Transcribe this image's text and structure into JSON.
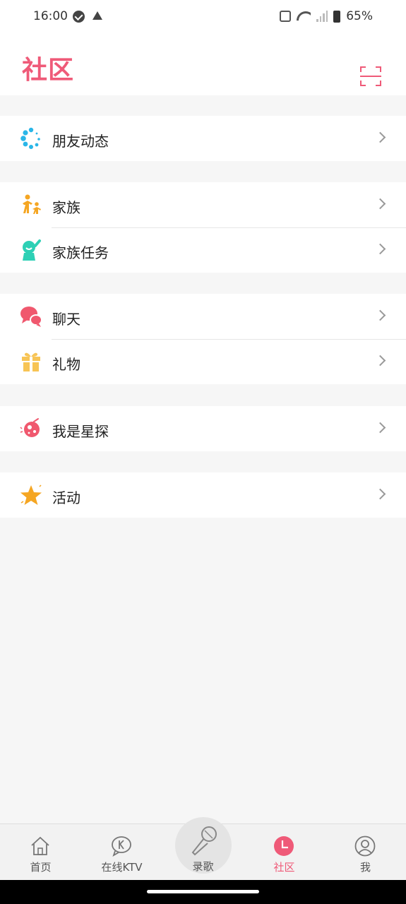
{
  "status_bar": {
    "time": "16:00",
    "battery": "65%",
    "icons": [
      "check-circle-icon",
      "warning-icon",
      "vibrate-icon",
      "wifi-icon",
      "signal-icon",
      "battery-icon"
    ]
  },
  "header": {
    "title": "社区",
    "scan_icon": "scan-icon"
  },
  "colors": {
    "accent": "#ef5a78",
    "background": "#f6f6f6",
    "card": "#ffffff"
  },
  "groups": [
    {
      "items": [
        {
          "label": "朋友动态",
          "icon": "friends-feed-icon"
        }
      ]
    },
    {
      "items": [
        {
          "label": "家族",
          "icon": "family-icon"
        },
        {
          "label": "家族任务",
          "icon": "family-task-icon"
        }
      ]
    },
    {
      "items": [
        {
          "label": "聊天",
          "icon": "chat-icon"
        },
        {
          "label": "礼物",
          "icon": "gift-icon"
        }
      ]
    },
    {
      "items": [
        {
          "label": "我是星探",
          "icon": "talent-scout-icon"
        }
      ]
    },
    {
      "items": [
        {
          "label": "活动",
          "icon": "star-icon"
        }
      ]
    }
  ],
  "tabbar": {
    "tabs": [
      {
        "label": "首页",
        "icon": "home-icon",
        "active": false
      },
      {
        "label": "在线KTV",
        "icon": "ktv-icon",
        "active": false
      },
      {
        "label": "录歌",
        "icon": "microphone-icon",
        "active": false
      },
      {
        "label": "社区",
        "icon": "clock-icon",
        "active": true
      },
      {
        "label": "我",
        "icon": "profile-icon",
        "active": false
      }
    ]
  }
}
